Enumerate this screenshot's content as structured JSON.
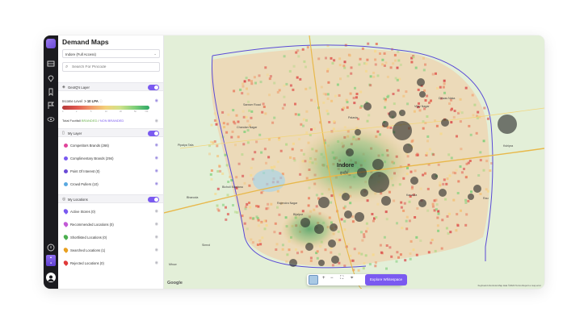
{
  "app": {
    "title": "Demand Maps",
    "city_select": "Indore (Full Access)",
    "search_placeholder": "Search For Pincode"
  },
  "geoiq_layer": {
    "label": "GeoIQ's Layer",
    "income_label": "Income Level",
    "income_value": "> 10 LPA",
    "footfall_label": "Total Footfall",
    "branded": "BRANDED",
    "non_branded": "NON BRANDED",
    "income_ticks": [
      "0",
      "2",
      "5",
      "10",
      "20",
      "50",
      ">50"
    ]
  },
  "my_layer": {
    "label": "My Layer",
    "items": [
      {
        "label": "Competitors Brands (266)",
        "color": "#e0449a"
      },
      {
        "label": "Complimentary Brands (294)",
        "color": "#7a5af0"
      },
      {
        "label": "Point Of Interest (0)",
        "color": "#6a4ad6"
      },
      {
        "label": "Crowd Pullers (10)",
        "color": "#5aa9e0"
      }
    ]
  },
  "my_locations": {
    "label": "My Locations",
    "items": [
      {
        "label": "Active Stores (0)",
        "color": "#7a5af0"
      },
      {
        "label": "Recommended Locations (0)",
        "color": "#c25ad6"
      },
      {
        "label": "Shortlisted Locations (0)",
        "color": "#4caf50"
      },
      {
        "label": "Searched Locations (1)",
        "color": "#e8a020"
      },
      {
        "label": "Rejected Locations (0)",
        "color": "#e03a3a"
      }
    ]
  },
  "map": {
    "city_label": "Indore",
    "city_label_local": "इन्दौर",
    "places": [
      "Pipalya Tafa",
      "Bhanoda",
      "Mhow",
      "Simrol",
      "Kshipra",
      "Dewas Naka",
      "Rajendra Nagar",
      "Bijalpur",
      "Chandan Nagar",
      "Kanadia",
      "Palasia",
      "Vijay Nagar",
      "Bicholi Mardana",
      "Rau",
      "Sanwer Road"
    ],
    "explore_button": "Explore Whitespace",
    "google": "Google",
    "attribution": "Keyboard shortcuts   Map data ©2024   Terms   Report a map error"
  },
  "colors": {
    "accent": "#7a5af0",
    "rail_bg": "#1b1b1f"
  }
}
